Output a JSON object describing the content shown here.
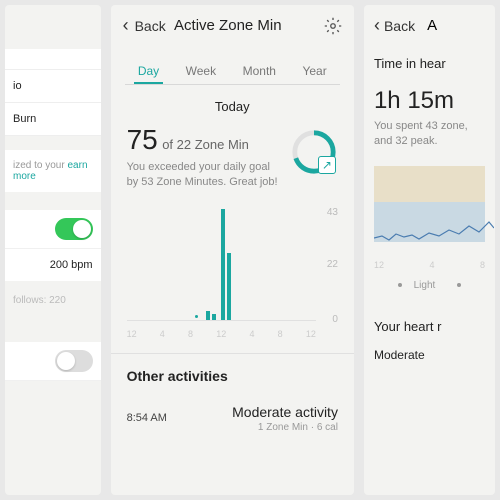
{
  "screen1": {
    "rows": [
      "",
      "io",
      "Burn"
    ],
    "note_text": "ized to your",
    "note_link": "earn more",
    "bpm_value": "200 bpm",
    "sub_text": "follows: 220",
    "toggles": [
      true,
      false
    ]
  },
  "screen2": {
    "back_label": "Back",
    "title": "Active Zone Min",
    "tabs": [
      "Day",
      "Week",
      "Month",
      "Year"
    ],
    "active_tab": 0,
    "period": "Today",
    "value": "75",
    "value_suffix": "of 22 Zone Min",
    "exceeded": "You exceeded your daily goal by 53 Zone Minutes. Great job!",
    "chart_data": {
      "type": "bar",
      "x_ticks": [
        "12",
        "4",
        "8",
        "12",
        "4",
        "8",
        "12"
      ],
      "y_ticks": [
        "43",
        "22",
        "0"
      ],
      "ylim": [
        0,
        43
      ],
      "bars": [
        {
          "x_pct": 42,
          "value": 3
        },
        {
          "x_pct": 45,
          "value": 2
        },
        {
          "x_pct": 50,
          "value": 43
        },
        {
          "x_pct": 53,
          "value": 26
        }
      ],
      "dots": [
        {
          "x_pct": 36
        }
      ]
    },
    "other_heading": "Other activities",
    "activities": [
      {
        "time": "8:54 AM",
        "name": "Moderate activity",
        "sub": "1 Zone Min · 6 cal"
      }
    ]
  },
  "screen3": {
    "back_label": "Back",
    "title_partial": "A",
    "section_title": "Time in hear",
    "big_time": "1h 15m",
    "desc": "You spent 43 zone, and 32 peak.",
    "chart_data": {
      "type": "line",
      "x_ticks": [
        "12",
        "4",
        "8"
      ]
    },
    "legend": [
      "Light"
    ],
    "section2_title": "Your heart r",
    "item": "Moderate"
  }
}
